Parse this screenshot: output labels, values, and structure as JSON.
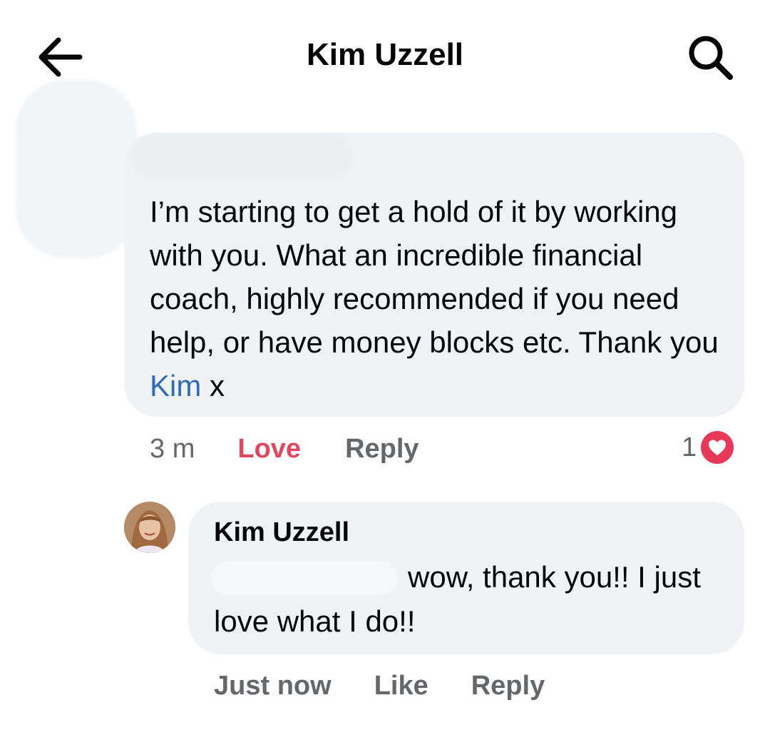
{
  "header": {
    "title": "Kim Uzzell",
    "back_icon": "arrow-left-icon",
    "search_icon": "search-icon"
  },
  "comment": {
    "text": "I’m starting to get a hold of it by working with you.  What an incredible financial coach, highly recommended if you need help, or have money blocks etc.  Thank you ",
    "mention": "Kim",
    "text_end": " x",
    "time": "3 m",
    "love_label": "Love",
    "reply_label": "Reply",
    "reaction_count": "1",
    "reaction_icon": "heart-icon",
    "love_color": "#e0485f",
    "mention_color": "#2f6eb5"
  },
  "reply": {
    "author": "Kim Uzzell",
    "text": "wow, thank you!! I just love what I do!!",
    "time": "Just now",
    "like_label": "Like",
    "reply_label": "Reply"
  }
}
